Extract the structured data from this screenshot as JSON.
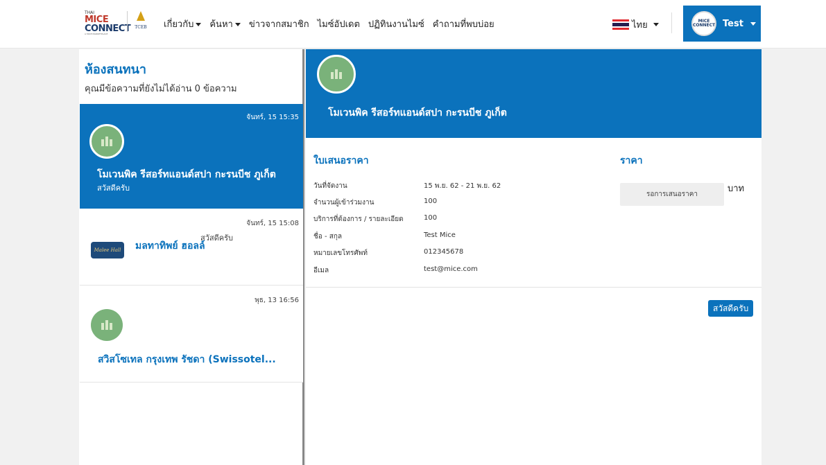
{
  "header": {
    "logo": {
      "small": "THAI",
      "big_prefix": "MICE",
      "big": "CONNECT",
      "tagline": "A MICE MARKETPLACE"
    },
    "tceb_label": "TCEB",
    "nav": [
      {
        "label": "เกี่ยวกับ",
        "dropdown": true
      },
      {
        "label": "ค้นหา",
        "dropdown": true
      },
      {
        "label": "ข่าวจากสมาชิก",
        "dropdown": false
      },
      {
        "label": "ไมซ์อัปเดต",
        "dropdown": false
      },
      {
        "label": "ปฏิทินงานไมซ์",
        "dropdown": false
      },
      {
        "label": "คำถามที่พบบ่อย",
        "dropdown": false
      }
    ],
    "language": "ไทย",
    "user": {
      "name": "Test",
      "avatar_text": "MICE CONNECT"
    },
    "colors": {
      "primary": "#0b72bc",
      "flag_red": "#e0282e",
      "flag_white": "#ffffff",
      "flag_blue": "#241d4f"
    }
  },
  "sidebar": {
    "title": "ห้องสนทนา",
    "unread": "คุณมีข้อความที่ยังไม่ได้อ่าน 0 ข้อความ",
    "chats": [
      {
        "time": "จันทร์, 15 15:35",
        "name": "โมเวนพิค รีสอร์ทแอนด์สปา กะรนบีช ภูเก็ต",
        "message": "สวัสดีครับ",
        "avatar": "building-icon",
        "active": true
      },
      {
        "time": "จันทร์, 15 15:08",
        "name": "มลทาทิพย์ ฮอลล์",
        "message": "สวัสดีครับ",
        "avatar": "hotel-logo",
        "logo_text": "Malee Hall",
        "active": false
      },
      {
        "time": "พุธ, 13 16:56",
        "name": "สวิสโซเทล กรุงเทพ รัชดา (Swissotel...",
        "message": "",
        "avatar": "building-icon",
        "active": false
      }
    ]
  },
  "conversation": {
    "title": "โมเวนพิค รีสอร์ทแอนด์สปา กะรนบีช ภูเก็ต",
    "quote": {
      "heading": "ใบเสนอราคา",
      "rows": [
        {
          "label": "วันที่จัดงาน",
          "value": "15 พ.ย. 62 - 21 พ.ย. 62"
        },
        {
          "label": "จำนวนผู้เข้าร่วมงาน",
          "value": "100"
        },
        {
          "label": "บริการที่ต้องการ / รายละเอียด",
          "value": "100"
        },
        {
          "label": "ชื่อ - สกุล",
          "value": "Test Mice"
        },
        {
          "label": "หมายเลขโทรศัพท์",
          "value": "012345678"
        },
        {
          "label": "อีเมล",
          "value": "test@mice.com"
        }
      ],
      "price_heading": "ราคา",
      "price_status": "รอการเสนอราคา",
      "currency": "บาท"
    },
    "messages": [
      {
        "text": "สวัสดีครับ",
        "from": "user"
      }
    ]
  }
}
